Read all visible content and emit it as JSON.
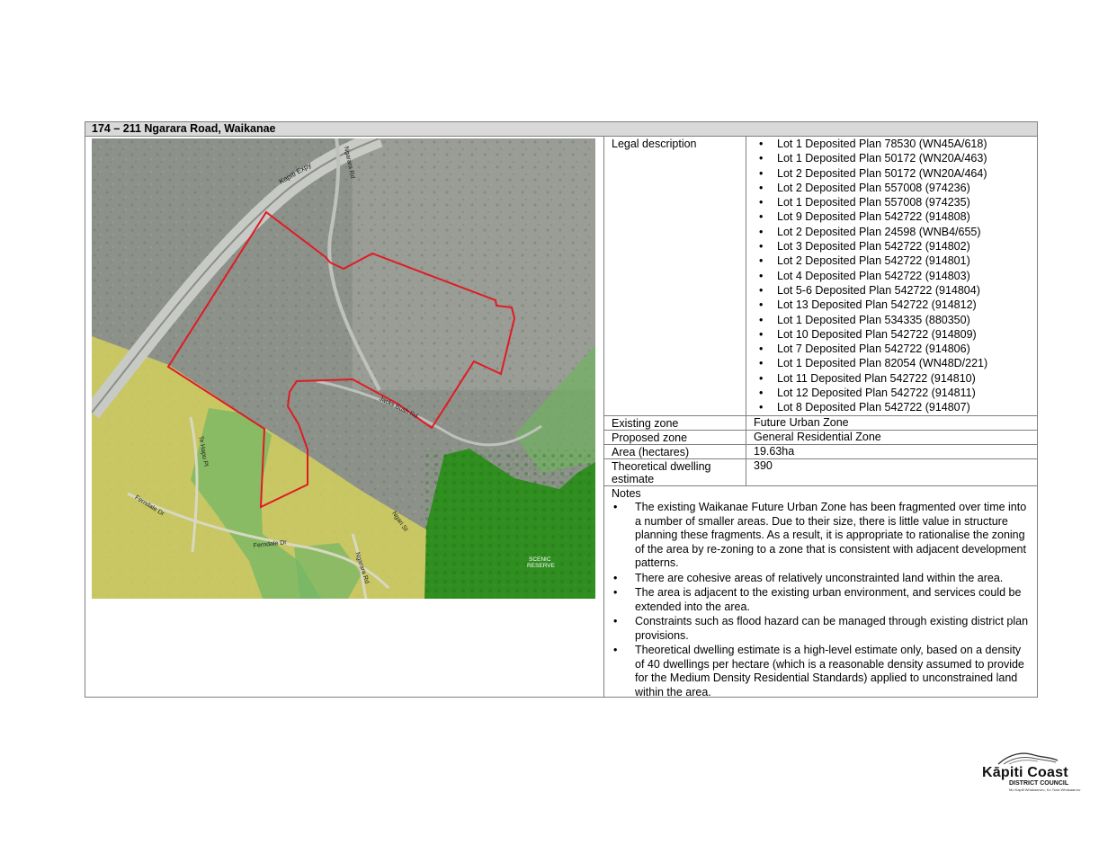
{
  "site": {
    "title": "174 – 211 Ngarara Road, Waikanae"
  },
  "map": {
    "road_labels": [
      "Kapiti Expy",
      "Ngarara Rd",
      "Jacks Bush Rd",
      "Te Hapu Pl",
      "Ferndale Dr",
      "Ferndale Dr",
      "Ngarara Rd",
      "Ngari St"
    ],
    "reserve_label": [
      "SCENIC",
      "RESERVE"
    ],
    "colors": {
      "boundary": "#e01b24",
      "residential_zone": "#d7d65a",
      "open_space_zone": "#79b96a",
      "reserve_zone": "#2e8b1f",
      "aerial": "#8a8f86"
    }
  },
  "table": {
    "legal_description_label": "Legal description",
    "legal_description": [
      "Lot 1 Deposited Plan 78530 (WN45A/618)",
      "Lot 1 Deposited Plan 50172 (WN20A/463)",
      "Lot 2 Deposited Plan 50172 (WN20A/464)",
      "Lot 2 Deposited Plan 557008 (974236)",
      "Lot 1 Deposited Plan 557008 (974235)",
      "Lot 9 Deposited Plan 542722 (914808)",
      "Lot 2 Deposited Plan 24598 (WNB4/655)",
      "Lot 3 Deposited Plan 542722 (914802)",
      "Lot 2 Deposited Plan 542722 (914801)",
      "Lot 4 Deposited Plan 542722 (914803)",
      "Lot 5-6 Deposited Plan 542722 (914804)",
      "Lot 13 Deposited Plan 542722 (914812)",
      "Lot 1 Deposited Plan 534335 (880350)",
      "Lot 10 Deposited Plan 542722 (914809)",
      "Lot 7 Deposited Plan 542722 (914806)",
      "Lot 1 Deposited Plan 82054 (WN48D/221)",
      "Lot 11 Deposited Plan 542722 (914810)",
      "Lot 12 Deposited Plan 542722 (914811)",
      "Lot 8 Deposited Plan 542722 (914807)"
    ],
    "existing_zone_label": "Existing zone",
    "existing_zone": "Future Urban Zone",
    "proposed_zone_label": "Proposed zone",
    "proposed_zone": "General Residential Zone",
    "area_label": "Area (hectares)",
    "area": "19.63ha",
    "dwelling_label": "Theoretical dwelling estimate",
    "dwelling": "390",
    "notes_label": "Notes",
    "notes": [
      "The existing Waikanae Future Urban Zone has been fragmented over time into a number of smaller areas. Due to their size, there is little value in structure planning these fragments. As a result, it is appropriate to rationalise the zoning of the area by re-zoning to a zone that is consistent with adjacent development patterns.",
      "There are cohesive areas of relatively unconstrainted land within the area.",
      "The area is adjacent to the existing urban environment, and services could be extended into the area.",
      "Constraints such as flood hazard can be managed through existing district plan provisions.",
      "Theoretical dwelling estimate is a high-level estimate only, based on a density of 40 dwellings per hectare (which is a reasonable density assumed to provide for the Medium Density Residential Standards) applied to unconstrained land within the area."
    ]
  },
  "logo": {
    "name": "Kāpiti Coast",
    "sub": "DISTRICT COUNCIL",
    "tagline": "Mo Kapiti Whakaaroro, Ko Tona Whakaaroro"
  }
}
